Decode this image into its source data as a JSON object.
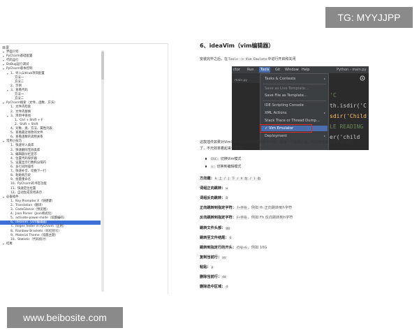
{
  "watermark_top": "TG: MYYJJPP",
  "watermark_bottom": "www.beibosite.com",
  "toc": {
    "title": "目录",
    "items": [
      {
        "level": 0,
        "caret": true,
        "text": "界面介绍"
      },
      {
        "level": 0,
        "caret": true,
        "text": "PyCharm基础配置"
      },
      {
        "level": 0,
        "caret": true,
        "text": "代码运行"
      },
      {
        "level": 0,
        "caret": true,
        "text": "DeBug运行调试"
      },
      {
        "level": 0,
        "caret": true,
        "text": "PyCharm版本控制"
      },
      {
        "level": 1,
        "caret": true,
        "text": "1、导入GitHub项目配置"
      },
      {
        "level": 2,
        "caret": false,
        "text": "方法一"
      },
      {
        "level": 2,
        "caret": false,
        "text": "方法二"
      },
      {
        "level": 1,
        "caret": false,
        "text": "2、示例"
      },
      {
        "level": 1,
        "caret": true,
        "text": "3、查看代码"
      },
      {
        "level": 2,
        "caret": false,
        "text": "方法一"
      },
      {
        "level": 2,
        "caret": false,
        "text": "方法二"
      },
      {
        "level": 0,
        "caret": true,
        "text": "PyCharm搜索（文件、函数、方法）"
      },
      {
        "level": 1,
        "caret": false,
        "text": "1、文件内检索"
      },
      {
        "level": 1,
        "caret": false,
        "text": "2、文件内替换"
      },
      {
        "level": 1,
        "caret": true,
        "text": "3、项目中查找"
      },
      {
        "level": 2,
        "caret": false,
        "text": "1、Ctrl + Shift + F"
      },
      {
        "level": 2,
        "caret": false,
        "text": "2、Shift + Shift"
      },
      {
        "level": 1,
        "caret": false,
        "text": "4、对象、类、方法、属性列表"
      },
      {
        "level": 1,
        "caret": false,
        "text": "5、查看最近修改的文件"
      },
      {
        "level": 1,
        "caret": false,
        "text": "6、查看函数的调用关系"
      },
      {
        "level": 0,
        "caret": true,
        "text": "常用小技巧"
      },
      {
        "level": 1,
        "caret": false,
        "text": "1、快速导入类库"
      },
      {
        "level": 1,
        "caret": false,
        "text": "2、快速删除无效类库"
      },
      {
        "level": 1,
        "caret": false,
        "text": "3、编辑器分栏显示"
      },
      {
        "level": 1,
        "caret": false,
        "text": "4、位置代码保护器"
      },
      {
        "level": 1,
        "caret": false,
        "text": "5、设置显示行数和分隔符"
      },
      {
        "level": 1,
        "caret": false,
        "text": "6、多行同时操作"
      },
      {
        "level": 1,
        "caret": false,
        "text": "7、快速补全、切换下一行"
      },
      {
        "level": 1,
        "caret": false,
        "text": "8、粘贴板历史"
      },
      {
        "level": 1,
        "caret": false,
        "text": "9、批量重命名"
      },
      {
        "level": 1,
        "caret": false,
        "text": "10、PyCharm的书签功能"
      },
      {
        "level": 1,
        "caret": false,
        "text": "11、快速定位位置"
      },
      {
        "level": 1,
        "caret": false,
        "text": "12、自动生成常用表示"
      },
      {
        "level": 0,
        "caret": true,
        "text": "必备插件"
      },
      {
        "level": 1,
        "caret": false,
        "text": "1、Key Promoter X（快捷键）"
      },
      {
        "level": 1,
        "caret": false,
        "text": "2、Translation（翻译）"
      },
      {
        "level": 1,
        "caret": false,
        "text": "3、CodeGlance（预览图）"
      },
      {
        "level": 1,
        "caret": false,
        "text": "4、Json Parser（Json格式化）"
      },
      {
        "level": 1,
        "caret": false,
        "text": "5、activate-power-mode（炫酷编码）"
      },
      {
        "level": 1,
        "caret": false,
        "text": "6、ideaVim（vim编辑器）",
        "active": true
      },
      {
        "level": 1,
        "caret": false,
        "text": "7、Regex Tester in PyCharm（正则）"
      },
      {
        "level": 1,
        "caret": false,
        "text": "8、Rainbow Brackets（彩虹括号）"
      },
      {
        "level": 1,
        "caret": false,
        "text": "9、Material Theme（炫酷主题）"
      },
      {
        "level": 1,
        "caret": false,
        "text": "10、Statistic（代码统计）"
      },
      {
        "level": 0,
        "caret": true,
        "text": "结尾"
      }
    ]
  },
  "section": {
    "heading": "6、ideaVim（vim编辑器）",
    "intro_pre": "安装完毕之后，在",
    "intro_code": "Tools -> Vim Emulate",
    "intro_post": "中进行开启和关闭"
  },
  "screenshot": {
    "menu": [
      "ctor",
      "Run",
      "Tools",
      "Git",
      "Window",
      "Help"
    ],
    "menu_selected": "Tools",
    "window_title": "Python - main.py",
    "tab": "main.py",
    "dropdown": [
      {
        "label": "Tasks & Contexts",
        "dim": false,
        "sub": true
      },
      {
        "label": "Save as Live Template...",
        "dim": true,
        "sub": false
      },
      {
        "label": "Save File as Template...",
        "dim": false,
        "sub": false
      },
      {
        "label": "IDE Scripting Console",
        "dim": false,
        "sub": false
      },
      {
        "label": "XML Actions",
        "dim": false,
        "sub": true
      },
      {
        "label": "Stack Trace or Thread Dump...",
        "dim": false,
        "sub": false
      },
      {
        "label": "✓ Vim Emulator",
        "dim": false,
        "sub": false
      },
      {
        "label": "Deployment",
        "dim": false,
        "sub": true
      }
    ],
    "code_lines": [
      "'C",
      "th.isdir('C",
      "sdir('Child",
      "LE READING",
      "er('child"
    ]
  },
  "body": {
    "para": "这款插件如果对Vim不熟悉的刚开始用回很不习惯，但是一旦熟悉之后，可以完全脱离鼠标进行编码",
    "para2": "了，不光效率着起来也很装X。",
    "bullets": [
      {
        "code": "ESC:",
        "text": "切换Vim模式"
      },
      {
        "code": "i:",
        "text": "切换到编辑模式"
      }
    ]
  },
  "commands": [
    {
      "label": "方向键：",
      "value": "k 上 / j 下 / h 左 / l 右",
      "note": ""
    },
    {
      "label": "词组正向跳转：",
      "value": "w",
      "note": ""
    },
    {
      "label": "词组反向跳转：",
      "value": "B",
      "note": ""
    },
    {
      "label": "正向跳转到指定字符：",
      "value": "f+字符",
      "note": "，例如 fh 正向跳转到h字符"
    },
    {
      "label": "反向跳转到指定字符：",
      "value": "F+字符",
      "note": "，例如 Fh 反向跳转到h字符"
    },
    {
      "label": "跳转文件头部：",
      "value": "gg",
      "note": ""
    },
    {
      "label": "跳转至文件结尾：",
      "value": "G",
      "note": ""
    },
    {
      "label": "跳转到指定行的开头：",
      "value": "行号+G",
      "note": "，例如 10G"
    },
    {
      "label": "复制当前行：",
      "value": "yy",
      "note": ""
    },
    {
      "label": "粘贴：",
      "value": "p",
      "note": ""
    },
    {
      "label": "删除当前行：",
      "value": "dd",
      "note": ""
    },
    {
      "label": "删除选中区域：",
      "value": "d",
      "note": ""
    }
  ]
}
